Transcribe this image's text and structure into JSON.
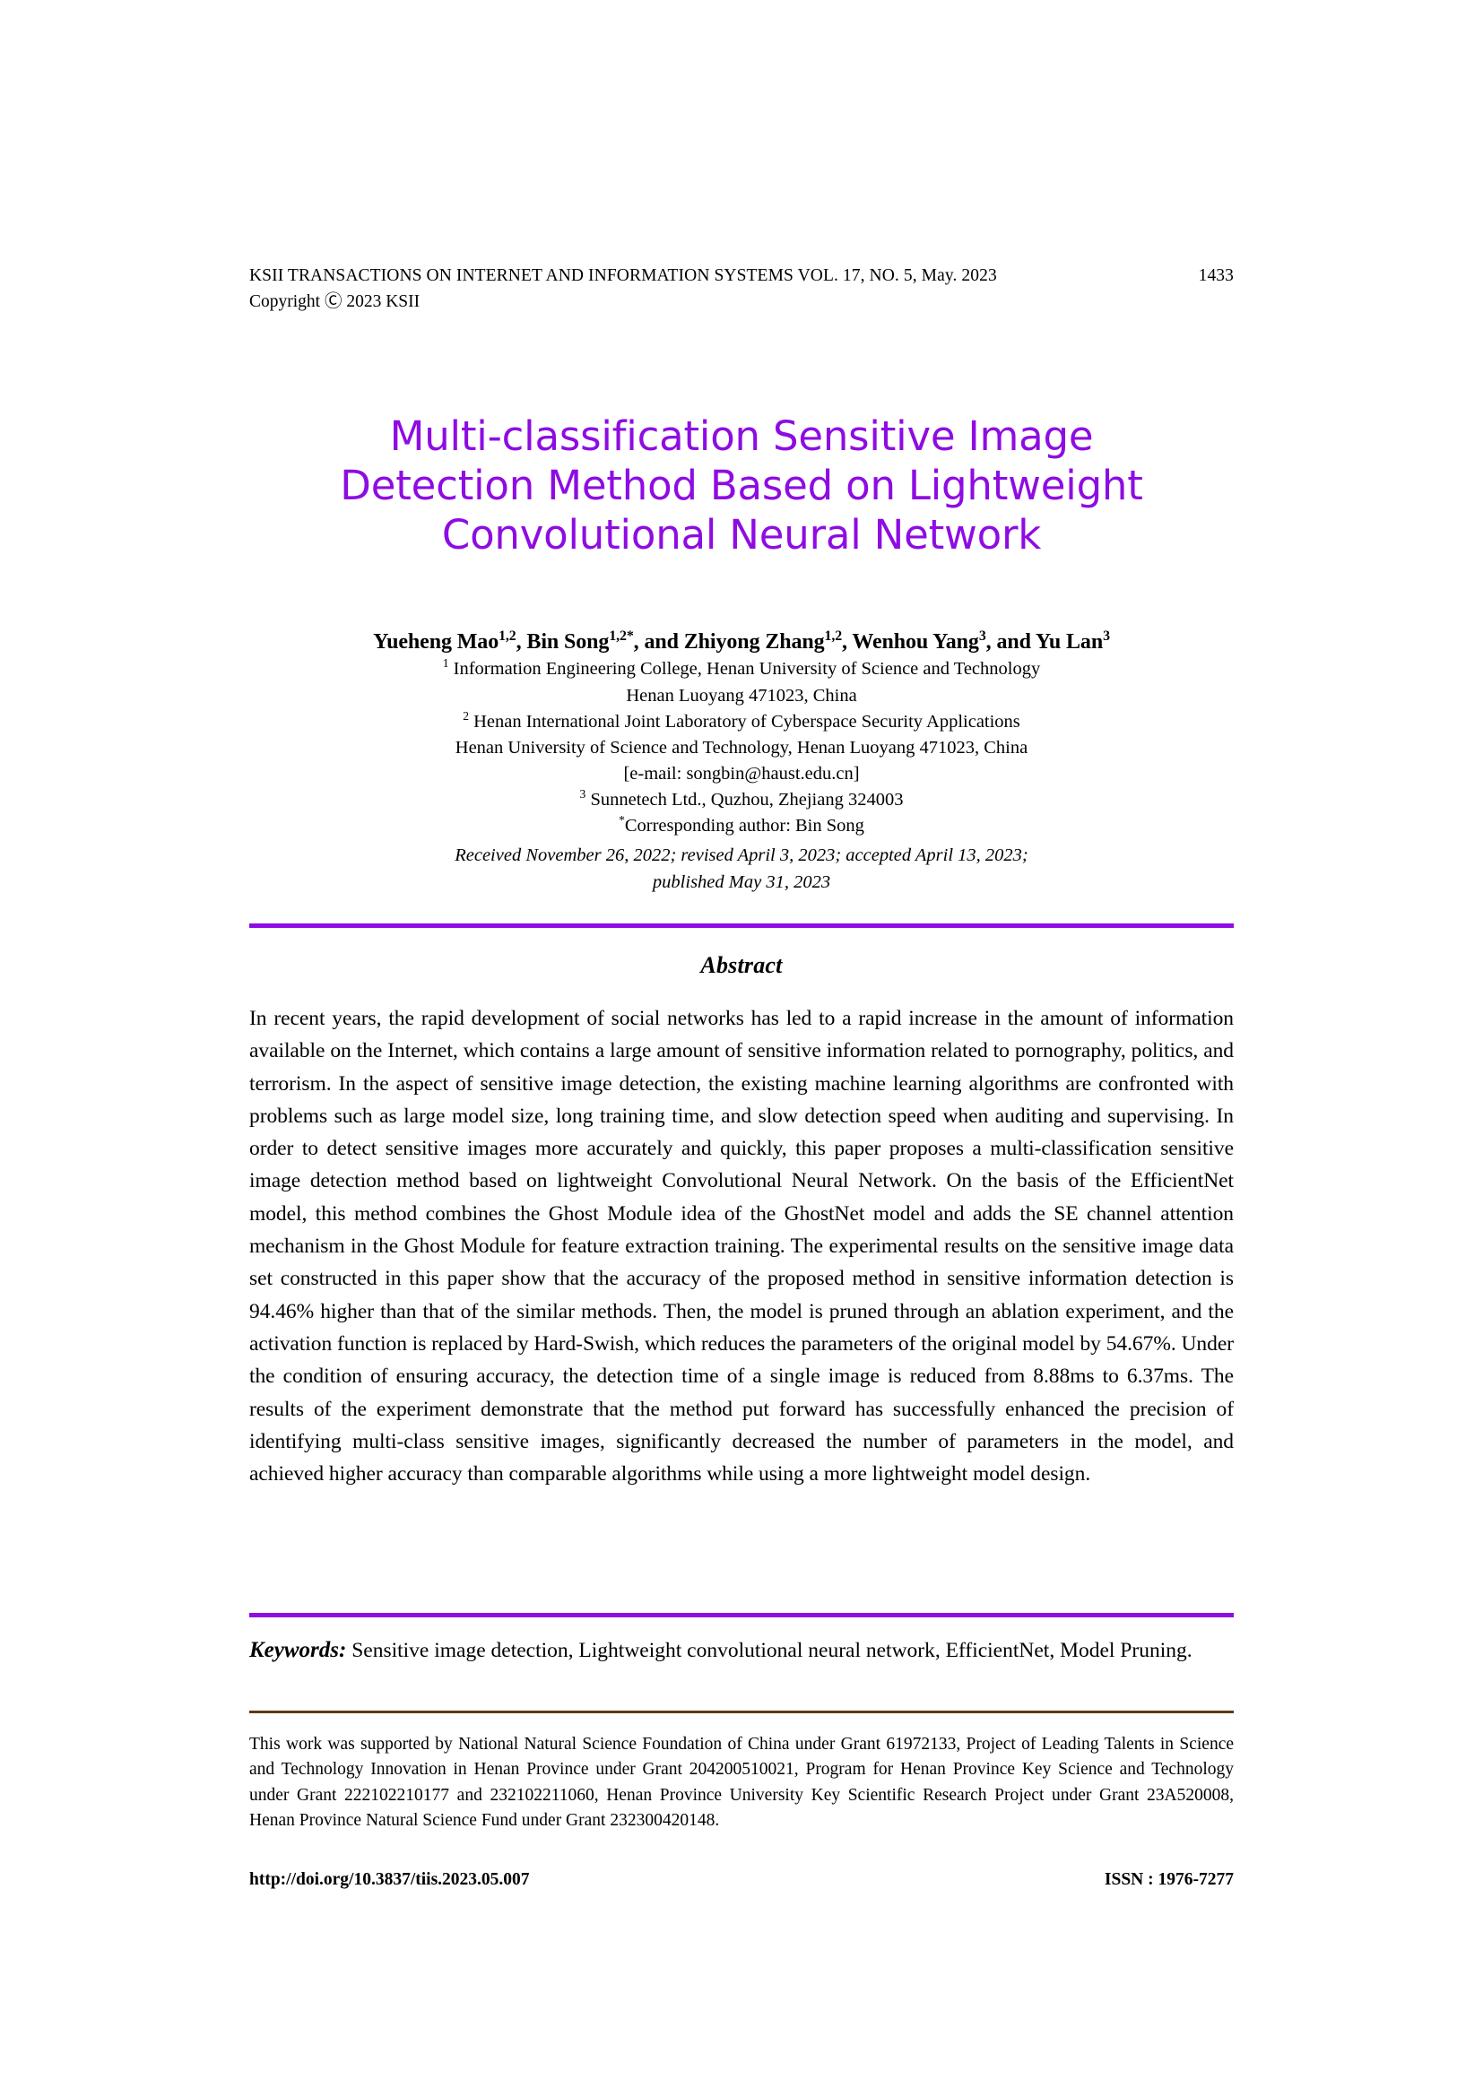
{
  "colors": {
    "title_purple": "#8E0CE3",
    "rule_purple": "#8E0CE3",
    "rule_brown": "#5C3A13",
    "text": "#000000"
  },
  "running_head": {
    "journal_line": "KSII TRANSACTIONS ON INTERNET AND INFORMATION SYSTEMS VOL. 17, NO. 5, May. 2023",
    "page_number": "1433",
    "copyright": "Copyright Ⓒ 2023 KSII"
  },
  "title": {
    "line1": "Multi-classification Sensitive Image",
    "line2": "Detection Method Based on Lightweight",
    "line3": "Convolutional Neural Network"
  },
  "authors": {
    "byline_part1": "Yueheng Mao",
    "byline_sup1": "1,2",
    "byline_part2": ", Bin Song",
    "byline_sup2": "1,2*",
    "byline_part3": ", and Zhiyong Zhang",
    "byline_sup3": "1,2",
    "byline_part4": ", Wenhou Yang",
    "byline_sup4": "3",
    "byline_part5": ", and Yu Lan",
    "byline_sup5": "3",
    "affiliation1_sup": "1",
    "affiliation1": " Information Engineering College, Henan University of Science and Technology",
    "affiliation1b": "Henan Luoyang 471023, China",
    "affiliation2_sup": "2",
    "affiliation2": " Henan International Joint Laboratory of Cyberspace Security Applications",
    "affiliation2b": "Henan University of Science and Technology, Henan Luoyang 471023, China",
    "email": "[e-mail: songbin@haust.edu.cn]",
    "affiliation3_sup": "3",
    "affiliation3": " Sunnetech Ltd., Quzhou, Zhejiang 324003",
    "corresponding_sup": "*",
    "corresponding": "Corresponding author: Bin Song"
  },
  "dates": {
    "line1": "Received November 26, 2022; revised April 3, 2023; accepted April 13, 2023;",
    "line2": "published May 31, 2023"
  },
  "abstract": {
    "heading": "Abstract",
    "body": "In recent years, the rapid development of social networks has led to a rapid increase in the amount of information available on the Internet, which contains a large amount of sensitive information related to pornography, politics, and terrorism. In the aspect of sensitive image detection, the existing machine learning algorithms are confronted with problems such as large model size, long training time, and slow detection speed when auditing and supervising. In order to detect sensitive images more accurately and quickly, this paper proposes a multi-classification sensitive image detection method based on lightweight Convolutional Neural Network. On the basis of the EfficientNet model, this method combines the Ghost Module idea of the GhostNet model and adds the SE channel attention mechanism in the Ghost Module for feature extraction training. The experimental results on the sensitive image data set constructed in this paper show that the accuracy of the proposed method in sensitive information detection is 94.46% higher than that of the similar methods. Then, the model is pruned through an ablation experiment, and the activation function is replaced by Hard-Swish, which reduces the parameters of the original model by 54.67%. Under the condition of ensuring accuracy, the detection time of a single image is reduced from 8.88ms to 6.37ms. The results of the experiment demonstrate that the method put forward has successfully enhanced the precision of identifying multi-class sensitive images, significantly decreased the number of parameters in the model, and achieved higher accuracy than comparable algorithms while using a more lightweight model design."
  },
  "keywords": {
    "label": "Keywords:",
    "text": " Sensitive image detection, Lightweight convolutional neural network, EfficientNet, Model Pruning."
  },
  "funding": {
    "text": "This work was supported by National Natural Science Foundation of China under Grant 61972133, Project of Leading Talents in Science and Technology Innovation in Henan Province under Grant 204200510021, Program for Henan Province Key Science and Technology under Grant 222102210177 and 232102211060, Henan Province University Key Scientific Research Project under Grant 23A520008, Henan Province Natural Science Fund under Grant 232300420148."
  },
  "footer": {
    "doi": "http://doi.org/10.3837/tiis.2023.05.007",
    "issn": "ISSN : 1976-7277"
  }
}
